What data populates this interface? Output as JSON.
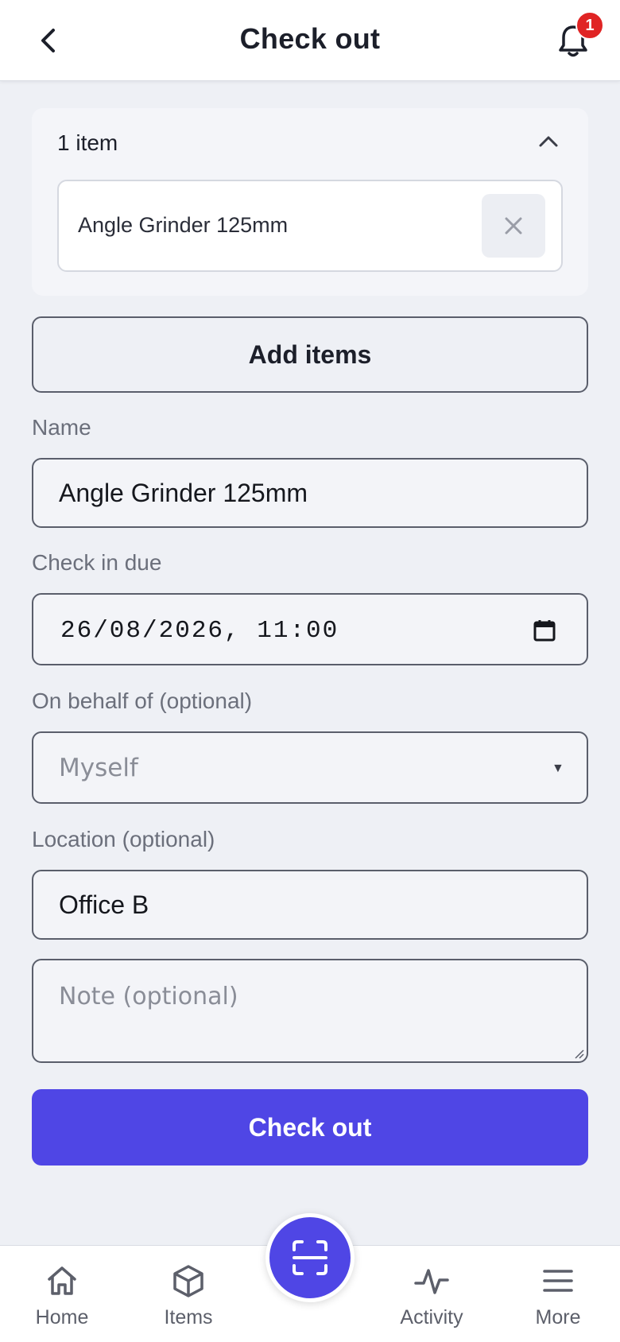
{
  "header": {
    "title": "Check out",
    "notification_count": "1"
  },
  "items_card": {
    "count_label": "1 item",
    "items": [
      {
        "name": "Angle Grinder 125mm"
      }
    ]
  },
  "add_items_label": "Add items",
  "form": {
    "name": {
      "label": "Name",
      "value": "Angle Grinder 125mm"
    },
    "check_in_due": {
      "label": "Check in due",
      "value": "26/08/2026, 11:00"
    },
    "on_behalf_of": {
      "label": "On behalf of (optional)",
      "selected": "Myself"
    },
    "location": {
      "label": "Location (optional)",
      "value": "Office B"
    },
    "note": {
      "placeholder": "Note (optional)"
    }
  },
  "submit_label": "Check out",
  "bottom_nav": {
    "items": [
      {
        "label": "Home",
        "icon": "home-icon"
      },
      {
        "label": "Items",
        "icon": "box-icon"
      },
      {
        "label": "Activity",
        "icon": "activity-icon"
      },
      {
        "label": "More",
        "icon": "menu-icon"
      }
    ],
    "scan_icon": "scan-icon"
  },
  "colors": {
    "accent": "#4f46e5",
    "badge": "#e02424",
    "background": "#eef0f5"
  }
}
